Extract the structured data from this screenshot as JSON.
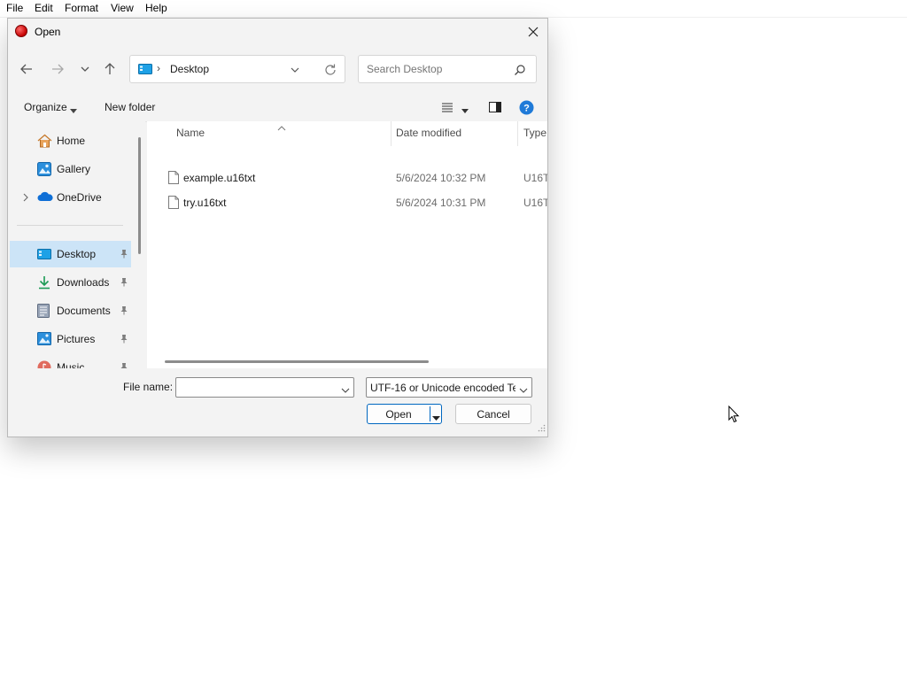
{
  "menubar": {
    "items": [
      {
        "label": "File"
      },
      {
        "label": "Edit"
      },
      {
        "label": "Format"
      },
      {
        "label": "View"
      },
      {
        "label": "Help"
      }
    ]
  },
  "dialog": {
    "title": "Open",
    "address": {
      "current_folder": "Desktop",
      "icon": "desktop-folder-icon"
    },
    "search": {
      "placeholder": "Search Desktop"
    },
    "toolbar": {
      "organize_label": "Organize",
      "new_folder_label": "New folder"
    },
    "sidebar": {
      "items": [
        {
          "label": "Home",
          "icon": "home-icon",
          "pinned": false
        },
        {
          "label": "Gallery",
          "icon": "gallery-icon",
          "pinned": false
        },
        {
          "label": "OneDrive",
          "icon": "onedrive-icon",
          "pinned": false,
          "expandable": true
        },
        {
          "label": "Desktop",
          "icon": "desktop-folder-icon",
          "pinned": true,
          "selected": true
        },
        {
          "label": "Downloads",
          "icon": "downloads-icon",
          "pinned": true
        },
        {
          "label": "Documents",
          "icon": "documents-icon",
          "pinned": true
        },
        {
          "label": "Pictures",
          "icon": "pictures-icon",
          "pinned": true
        },
        {
          "label": "Music",
          "icon": "music-icon",
          "pinned": true
        }
      ]
    },
    "file_list": {
      "columns": {
        "name": "Name",
        "date": "Date modified",
        "type": "Type"
      },
      "rows": [
        {
          "name": "example.u16txt",
          "date": "5/6/2024 10:32 PM",
          "type": "U16T"
        },
        {
          "name": "try.u16txt",
          "date": "5/6/2024 10:31 PM",
          "type": "U16T"
        }
      ]
    },
    "file_name": {
      "label": "File name:",
      "value": ""
    },
    "file_type": {
      "selected": "UTF-16 or Unicode encoded Te"
    },
    "buttons": {
      "open_label": "Open",
      "cancel_label": "Cancel"
    }
  },
  "colors": {
    "accent": "#0067c0",
    "selected_bg": "#cce4f7",
    "dialog_bg": "#f3f3f3"
  }
}
